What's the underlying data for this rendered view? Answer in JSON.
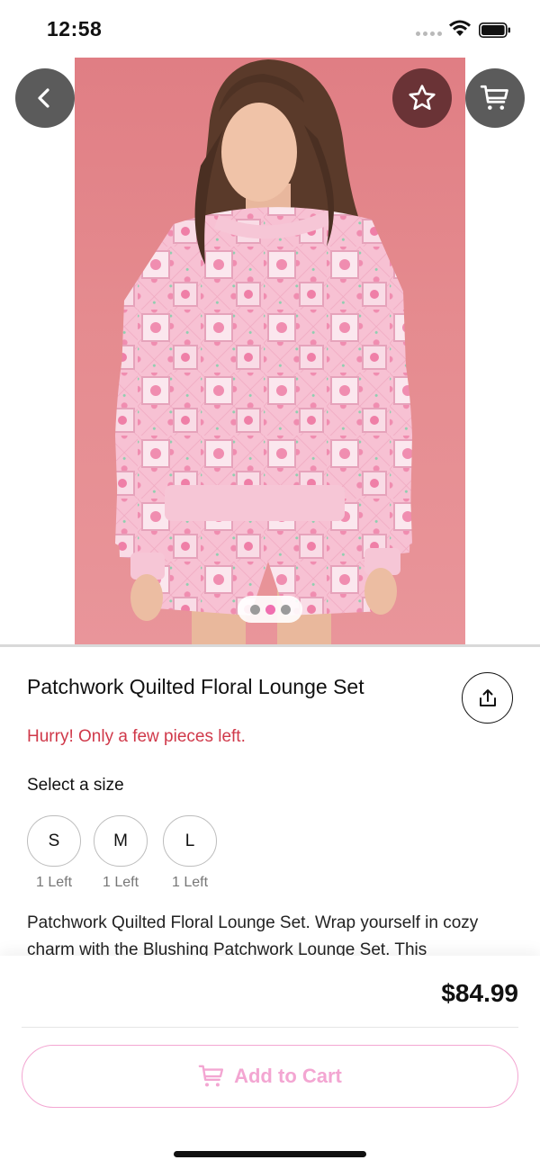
{
  "status_bar": {
    "time": "12:58"
  },
  "product": {
    "title": "Patchwork Quilted Floral Lounge Set",
    "stock_warning": "Hurry! Only a few pieces left.",
    "size_label": "Select a size",
    "sizes": [
      {
        "label": "S",
        "stock": "1 Left"
      },
      {
        "label": "M",
        "stock": "1 Left"
      },
      {
        "label": "L",
        "stock": "1 Left"
      }
    ],
    "description": "Patchwork Quilted Floral Lounge Set. Wrap yourself in cozy charm with the Blushing Patchwork Lounge Set. This",
    "price": "$84.99",
    "image_carousel": {
      "count": 3,
      "active_index": 1
    }
  },
  "actions": {
    "add_to_cart_label": "Add to Cart"
  },
  "icons": {
    "back": "chevron-left-icon",
    "favorite": "star-outline-icon",
    "cart": "cart-icon",
    "share": "share-icon"
  },
  "colors": {
    "accent_pink": "#f3a6d2",
    "warning_red": "#d0394a",
    "hero_background": "#e58b8f",
    "active_dot": "#f06fb0"
  }
}
